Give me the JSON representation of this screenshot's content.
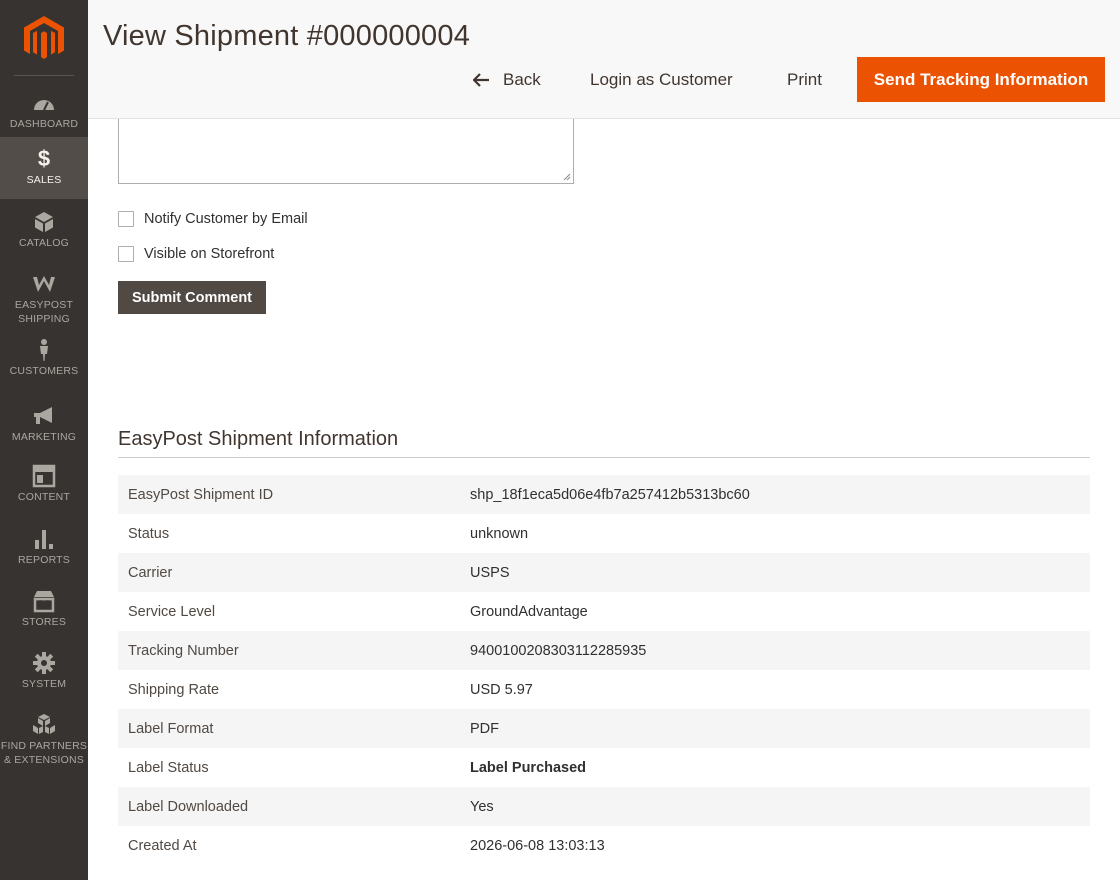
{
  "sidebar": {
    "items": [
      {
        "label": "DASHBOARD",
        "icon": "dashboard-icon"
      },
      {
        "label": "SALES",
        "icon": "dollar-icon"
      },
      {
        "label": "CATALOG",
        "icon": "box-icon"
      },
      {
        "label": "EASYPOST",
        "label2": "SHIPPING",
        "icon": "easypost-icon"
      },
      {
        "label": "CUSTOMERS",
        "icon": "person-icon"
      },
      {
        "label": "MARKETING",
        "icon": "megaphone-icon"
      },
      {
        "label": "CONTENT",
        "icon": "layout-icon"
      },
      {
        "label": "REPORTS",
        "icon": "bar-chart-icon"
      },
      {
        "label": "STORES",
        "icon": "store-icon"
      },
      {
        "label": "SYSTEM",
        "icon": "gear-icon"
      },
      {
        "label": "FIND PARTNERS",
        "label2": "& EXTENSIONS",
        "icon": "cubes-icon"
      }
    ],
    "active": "SALES"
  },
  "header": {
    "title": "View Shipment #000000004",
    "back_label": "Back",
    "login_label": "Login as Customer",
    "print_label": "Print",
    "track_label": "Send Tracking Information"
  },
  "comment_form": {
    "notify_label": "Notify Customer by Email",
    "visible_label": "Visible on Storefront",
    "submit_label": "Submit Comment"
  },
  "easypost": {
    "title": "EasyPost Shipment Information",
    "rows": [
      {
        "key": "EasyPost Shipment ID",
        "value": "shp_18f1eca5d06e4fb7a257412b5313bc60"
      },
      {
        "key": "Status",
        "value": "unknown"
      },
      {
        "key": "Carrier",
        "value": "USPS"
      },
      {
        "key": "Service Level",
        "value": "GroundAdvantage"
      },
      {
        "key": "Tracking Number",
        "value": "9400100208303112285935"
      },
      {
        "key": "Shipping Rate",
        "value": "USD 5.97"
      },
      {
        "key": "Label Format",
        "value": "PDF"
      },
      {
        "key": "Label Status",
        "value": "Label Purchased"
      },
      {
        "key": "Label Downloaded",
        "value": "Yes"
      },
      {
        "key": "Created At",
        "value": "2026-06-08 13:03:13"
      }
    ]
  },
  "colors": {
    "accent": "#eb5202",
    "sidebar_bg": "#373330",
    "success": "#128008"
  }
}
